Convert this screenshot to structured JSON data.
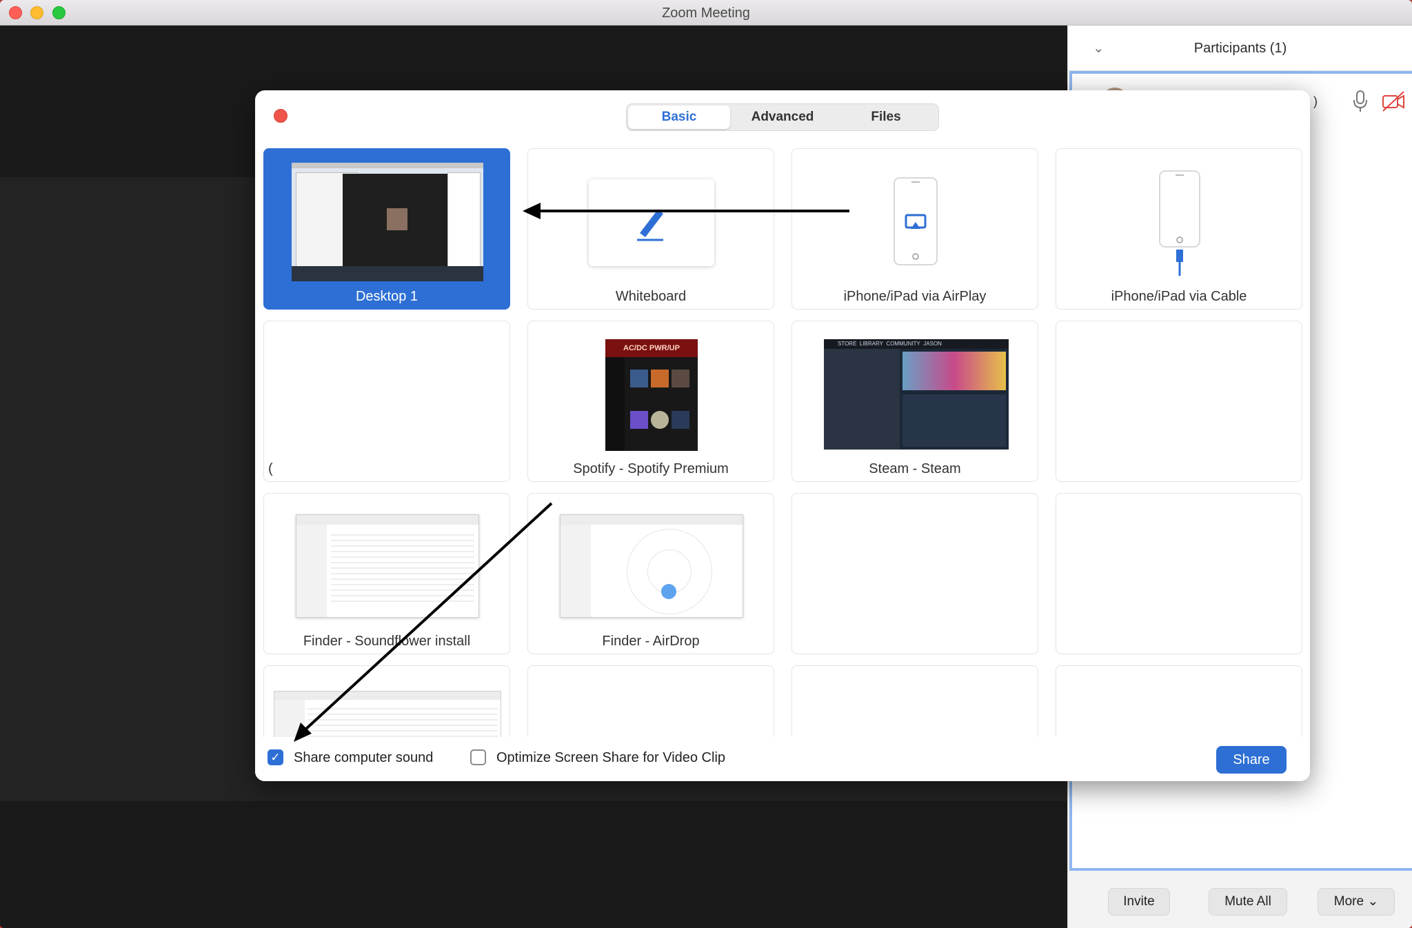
{
  "window": {
    "title": "Zoom Meeting"
  },
  "participants_panel": {
    "title": "Participants (1)",
    "participant_name": ")",
    "buttons": {
      "invite": "Invite",
      "mute_all": "Mute All",
      "more": "More"
    }
  },
  "share_dialog": {
    "tabs": [
      "Basic",
      "Advanced",
      "Files"
    ],
    "active_tab": "Basic",
    "sources": [
      {
        "label": "Desktop 1",
        "selected": true
      },
      {
        "label": "Whiteboard"
      },
      {
        "label": "iPhone/iPad via AirPlay"
      },
      {
        "label": "iPhone/iPad via Cable"
      },
      {
        "label": "("
      },
      {
        "label": "Spotify - Spotify Premium"
      },
      {
        "label": "Steam - Steam"
      },
      {
        "label": ""
      },
      {
        "label": "Finder - Soundflower install"
      },
      {
        "label": "Finder - AirDrop"
      }
    ],
    "spotify_banner": "AC/DC PWR/UP",
    "steam_nav": [
      "STORE",
      "LIBRARY",
      "COMMUNITY",
      "JASON"
    ],
    "options": {
      "share_sound": {
        "label": "Share computer sound",
        "checked": true
      },
      "optimize_video": {
        "label": "Optimize Screen Share for Video Clip",
        "checked": false
      }
    },
    "share_button": "Share"
  },
  "colors": {
    "accent": "#2d6fd4",
    "close_red": "#f0554b"
  }
}
